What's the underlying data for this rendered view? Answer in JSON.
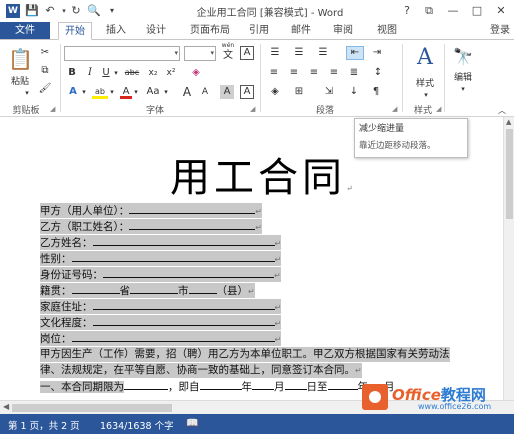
{
  "titlebar": {
    "app_icon": "W",
    "title": "企业用工合同 [兼容模式] - Word",
    "help": "?",
    "restore": "⧉",
    "minimize": "—",
    "maximize": "□",
    "close": "✕"
  },
  "tabs": {
    "file": "文件",
    "items": [
      "开始",
      "插入",
      "设计",
      "页面布局",
      "引用",
      "邮件",
      "审阅",
      "视图"
    ],
    "login": "登录"
  },
  "ribbon": {
    "clipboard": {
      "paste": "粘贴",
      "label": "剪贴板"
    },
    "font": {
      "label": "字体",
      "wen": "wén",
      "wen_char": "文",
      "A_box": "A",
      "bold": "B",
      "italic": "I",
      "underline": "U",
      "strike": "abc",
      "sub": "x₂",
      "sup": "x²",
      "text_effect": "A",
      "highlight": "ab",
      "font_color": "A",
      "case": "Aa",
      "grow": "A",
      "shrink": "A",
      "char_border": "A"
    },
    "paragraph": {
      "label": "段落"
    },
    "styles": {
      "button": "样式",
      "label": "样式"
    },
    "editing": {
      "button": "编辑"
    }
  },
  "tooltip": {
    "title": "减少缩进量",
    "description": "靠近边距移动段落。"
  },
  "document": {
    "title": "用工合同",
    "lines": [
      "甲方（用人单位）：",
      "乙方（职工姓名）：",
      "乙方姓名：",
      "性别：",
      "身份证号码：",
      "籍贯：",
      "家庭住址：",
      "文化程度：",
      "岗位："
    ],
    "jiguan_sheng": "省",
    "jiguan_shi": "市",
    "jiguan_xian": "（县）",
    "para1": "甲方因生产（工作）需要，招（聘）用乙方为本单位职工。甲乙双方根据国家有关劳动法",
    "para2": "律、法规规定，在平等自愿、协商一致的基础上，同意签订本合同。",
    "clause1_a": "一、本合同期限为",
    "clause1_b": "，即自",
    "clause1_c": "年",
    "clause1_d": "月",
    "clause1_e": "日至",
    "clause1_f": "年",
    "clause1_g": "月"
  },
  "statusbar": {
    "page": "第 1 页，共 2 页",
    "words": "1634/1638 个字"
  },
  "logo": {
    "brand": "Office",
    "brand_cn": "教程网",
    "site": "www.office26.com"
  }
}
